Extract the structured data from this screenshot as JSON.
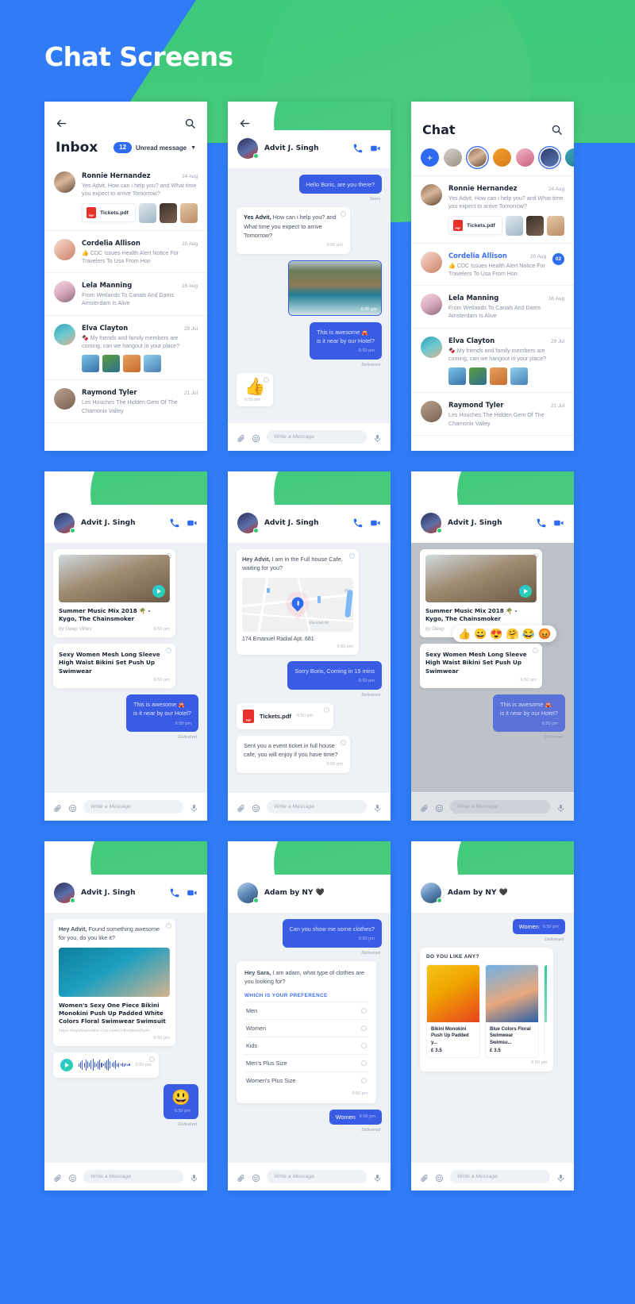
{
  "page": {
    "title": "Chat Screens"
  },
  "common": {
    "time": "6:50 pm",
    "delivered": "Delivered",
    "seen": "Seen",
    "composer_placeholder": "Write a Message",
    "back_icon": "back-arrow-icon",
    "search_icon": "search-icon",
    "call_icon": "phone-call-icon",
    "video_icon": "video-camera-icon",
    "attach_icon": "paperclip-icon",
    "emoji_icon": "emoji-smiley-icon",
    "mic_icon": "microphone-icon"
  },
  "screen1": {
    "name": "inbox-screen",
    "title": "Inbox",
    "unread_count": "12",
    "unread_label": "Unread message",
    "conversations": [
      {
        "name": "Ronnie Hernandez",
        "date": "24 Aug",
        "snippet": "Yes Advit, How can i help you? and What time you expect to arrive Tomorrow?",
        "pdf": "Tickets.pdf",
        "thumbs": 3
      },
      {
        "name": "Cordelia Allison",
        "date": "20 Aug",
        "snippet": "👍 CDC Issues Health Alert Notice For Travelers To Usa From Hon"
      },
      {
        "name": "Lela Manning",
        "date": "16 Aug",
        "snippet": "From Wetlands To Canals And Dams Amsterdam Is Alive"
      },
      {
        "name": "Elva Clayton",
        "date": "29 Jul",
        "snippet": "🍫 My friends and family members are coming, can we hangout in your place?",
        "thumbs": 4
      },
      {
        "name": "Raymond Tyler",
        "date": "21 Jul",
        "snippet": "Les Houches The Hidden Gem Of The Chamonix Valley"
      }
    ]
  },
  "screen2": {
    "name": "conversation-screen",
    "contact": "Advit J. Singh",
    "messages": [
      {
        "type": "out-text",
        "text": "Hello Boris, are you there?",
        "status": "Seen"
      },
      {
        "type": "in-text",
        "bold": "Yes Advit,",
        "text": " How can i help you? and What time you expect to arrive Tomorrow?",
        "time": "6:50 pm"
      },
      {
        "type": "out-photo",
        "caption": "coast-photo",
        "time": "6:50 pm"
      },
      {
        "type": "out-text2",
        "line1": "This is awesome 🎪",
        "line2": "is it near by our Hotel?",
        "time": "6:50 pm",
        "status": "Delivered"
      },
      {
        "type": "in-emoji",
        "emoji": "👍",
        "time": "6:50 pm"
      }
    ]
  },
  "screen3": {
    "name": "chat-list-screen",
    "title": "Chat",
    "stories_add": "+",
    "story_count": 6,
    "conversations": [
      {
        "name": "Ronnie Hernandez",
        "date": "24 Aug",
        "snippet": "Yes Advit, How can i help you? and What time you expect to arrive Tomorrow?",
        "pdf": "Tickets.pdf",
        "thumbs": 3,
        "unread": false
      },
      {
        "name": "Cordelia Allison",
        "date": "20 Aug",
        "snippet": "👍 CDC Issues Health Alert Notice For Travelers To Usa From Hon",
        "unread": true,
        "count": "02"
      },
      {
        "name": "Lela Manning",
        "date": "16 Aug",
        "snippet": "From Wetlands To Canals And Dams Amsterdam Is Alive"
      },
      {
        "name": "Elva Clayton",
        "date": "29 Jul",
        "snippet": "🍫 My friends and family members are coming, can we hangout in your place?",
        "thumbs": 4
      },
      {
        "name": "Raymond Tyler",
        "date": "21 Jul",
        "snippet": "Les Houches The Hidden Gem Of The Chamonix Valley"
      }
    ]
  },
  "screen4": {
    "name": "media-card-screen",
    "contact": "Advit J. Singh",
    "music_card": {
      "title": "Summer Music Mix 2018 🌴 - Kygo, The Chainsmoker",
      "subtitle": "by Deep Vibes",
      "time": "6:50 pm"
    },
    "product_text": {
      "text": "Sexy Women Mesh Long Sleeve High Waist Bikini Set Push Up Swimwear",
      "time": "6:50 pm"
    },
    "out_message": {
      "line1": "This is awesome 🎪",
      "line2": "is it near by our Hotel?",
      "time": "6:50 pm",
      "status": "Delivered"
    }
  },
  "screen5": {
    "name": "location-screen",
    "contact": "Advit J. Singh",
    "location_card": {
      "bold": "Hey Advit,",
      "text": " I am in the Full house Cafe, waiting for you?",
      "address": "174 Emanuel Radial Apt. 681",
      "time": "6:50 pm",
      "map_labels": [
        "Shanshah Rd",
        "Bh"
      ]
    },
    "out_message": {
      "text": "Sorry Boris, Coming in 15 mins",
      "time": "6:50 pm",
      "status": "Delivered"
    },
    "pdf_message": {
      "file": "Tickets.pdf",
      "time": "6:50 pm"
    },
    "in_message": {
      "text": "Sent you a event ticket in full house cafe, you will enjoy if you have time?",
      "time": "6:50 pm"
    }
  },
  "screen6": {
    "name": "reaction-screen",
    "contact": "Advit J. Singh",
    "music_card": {
      "title": "Summer Music Mix 2018 🌴 - Kygo, The Chainsmoker",
      "subtitle": "by Deep",
      "time": "6:50 pm"
    },
    "reactions": [
      "👍",
      "😀",
      "😍",
      "🤗",
      "😂",
      "😡"
    ],
    "product_text": {
      "text": "Sexy Women Mesh Long Sleeve High Waist Bikini Set Push Up Swimwear",
      "time": "6:50 pm"
    },
    "out_message": {
      "line1": "This is awesome 🎪",
      "line2": "is it near by our Hotel?",
      "time": "6:50 pm",
      "status": "Delivered"
    }
  },
  "screen7": {
    "name": "voice-note-screen",
    "contact": "Advit J. Singh",
    "intro": {
      "bold": "Hey Advit,",
      "text": " Found something awesome for you, do you like it?"
    },
    "product_card": {
      "title": "Women's Sexy One Piece Bikini Monokini Push Up Padded White Colors Floral Swimwear Swimsuit",
      "url": "https://myshoponline-con.com/collections/hum...",
      "time": "6:50 pm"
    },
    "voice_note": {
      "time": "6:50 pm"
    },
    "emoji_message": {
      "emoji": "😃",
      "time": "6:50 pm",
      "status": "Delivered"
    }
  },
  "screen8": {
    "name": "preference-screen",
    "contact": "Adam by NY 🖤",
    "out_message": {
      "text": "Can you show me some clothes?",
      "time": "6:50 pm",
      "status": "Delivered"
    },
    "question": {
      "bold": "Hey Sara,",
      "text": " I am adam, what type of clothes are you looking for?"
    },
    "pref_title": "WHICH IS YOUR PREFERENCE",
    "options": [
      "Men",
      "Women",
      "Kids",
      "Men's Plus Size",
      "Women's Plus Size"
    ],
    "answer": {
      "text": "Women",
      "time": "6:50 pm",
      "status": "Delivered"
    }
  },
  "screen9": {
    "name": "product-carousel-screen",
    "contact": "Adam by NY 🖤",
    "answer": {
      "text": "Women",
      "time": "6:50 pm",
      "status": "Delivered"
    },
    "carousel_title": "DO YOU LIKE ANY?",
    "products": [
      {
        "name": "Bikini Monokini Push Up Padded  y...",
        "price": "£ 3.5"
      },
      {
        "name": "Blue Colors Floral Swimwear Swimsu...",
        "price": "£ 3.5"
      },
      {
        "name": "",
        "price": ""
      }
    ],
    "time": "6:50 pm"
  }
}
